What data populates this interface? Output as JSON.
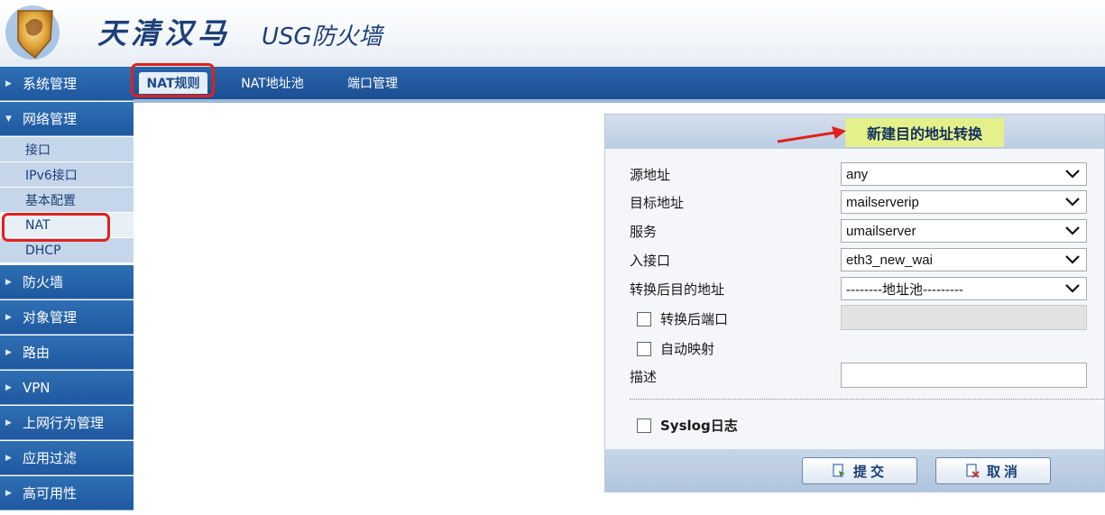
{
  "header": {
    "brand_cn": "天清汉马",
    "brand_en": "USG防火墙",
    "logo_icon": "shield-logo-icon"
  },
  "colors": {
    "nav_blue": "#1f58a0",
    "highlight_red": "#e0201b",
    "title_highlight": "#e4f18a"
  },
  "sidebar": {
    "groups_top": [
      {
        "label": "系统管理",
        "expanded": false
      }
    ],
    "expanded_group": {
      "label": "网络管理",
      "items": [
        "接口",
        "IPv6接口",
        "基本配置",
        "NAT",
        "DHCP"
      ],
      "active": "NAT"
    },
    "groups_bottom": [
      "防火墙",
      "对象管理",
      "路由",
      "VPN",
      "上网行为管理",
      "应用过滤",
      "高可用性"
    ]
  },
  "tabs": [
    {
      "label": "NAT规则",
      "active": true
    },
    {
      "label": "NAT地址池",
      "active": false
    },
    {
      "label": "端口管理",
      "active": false
    }
  ],
  "form": {
    "title": "新建目的地址转换",
    "fields": {
      "source": {
        "label": "源地址",
        "value": "any"
      },
      "dest": {
        "label": "目标地址",
        "value": "mailserverip"
      },
      "service": {
        "label": "服务",
        "value": "umailserver"
      },
      "iface": {
        "label": "入接口",
        "value": "eth3_new_wai"
      },
      "translated": {
        "label": "转换后目的地址",
        "value": "--------地址池---------"
      }
    },
    "port_checkbox": "转换后端口",
    "auto_checkbox": "自动映射",
    "desc_label": "描述",
    "syslog_checkbox": "Syslog日志",
    "submit": "提交",
    "cancel": "取消"
  }
}
